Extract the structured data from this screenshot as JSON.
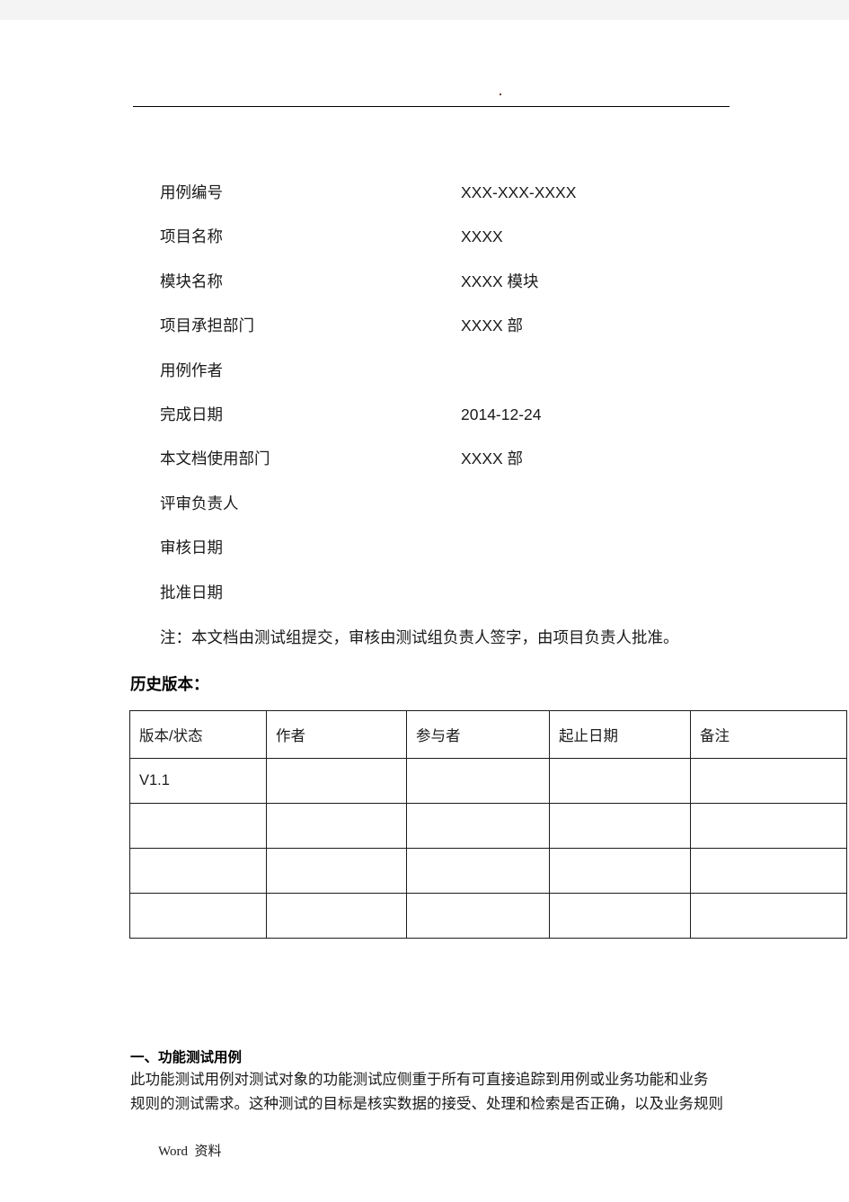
{
  "header": {
    "mark": "."
  },
  "cover_fields": [
    {
      "label": "用例编号",
      "value": "XXX-XXX-XXXX"
    },
    {
      "label": "项目名称",
      "value": "XXXX"
    },
    {
      "label": "模块名称",
      "value": "XXXX 模块"
    },
    {
      "label": "项目承担部门",
      "value": "XXXX 部"
    },
    {
      "label": "用例作者",
      "value": ""
    },
    {
      "label": "完成日期",
      "value": "2014-12-24"
    },
    {
      "label": "本文档使用部门",
      "value": "XXXX 部"
    },
    {
      "label": "评审负责人",
      "value": ""
    },
    {
      "label": "审核日期",
      "value": ""
    },
    {
      "label": "批准日期",
      "value": ""
    }
  ],
  "note": "注：本文档由测试组提交，审核由测试组负责人签字，由项目负责人批准。",
  "history": {
    "heading": "历史版本：",
    "columns": [
      "版本/状态",
      "作者",
      "参与者",
      "起止日期",
      "备注"
    ],
    "rows": [
      [
        "V1.1",
        "",
        "",
        "",
        ""
      ],
      [
        "",
        "",
        "",
        "",
        ""
      ],
      [
        "",
        "",
        "",
        "",
        ""
      ],
      [
        "",
        "",
        "",
        "",
        ""
      ]
    ]
  },
  "section": {
    "heading": "一、功能测试用例",
    "paragraph_line1": "此功能测试用例对测试对象的功能测试应侧重于所有可直接追踪到用例或业务功能和业务",
    "paragraph_line2": "规则的测试需求。这种测试的目标是核实数据的接受、处理和检索是否正确，以及业务规则"
  },
  "footer": {
    "text": "Word  资料"
  }
}
